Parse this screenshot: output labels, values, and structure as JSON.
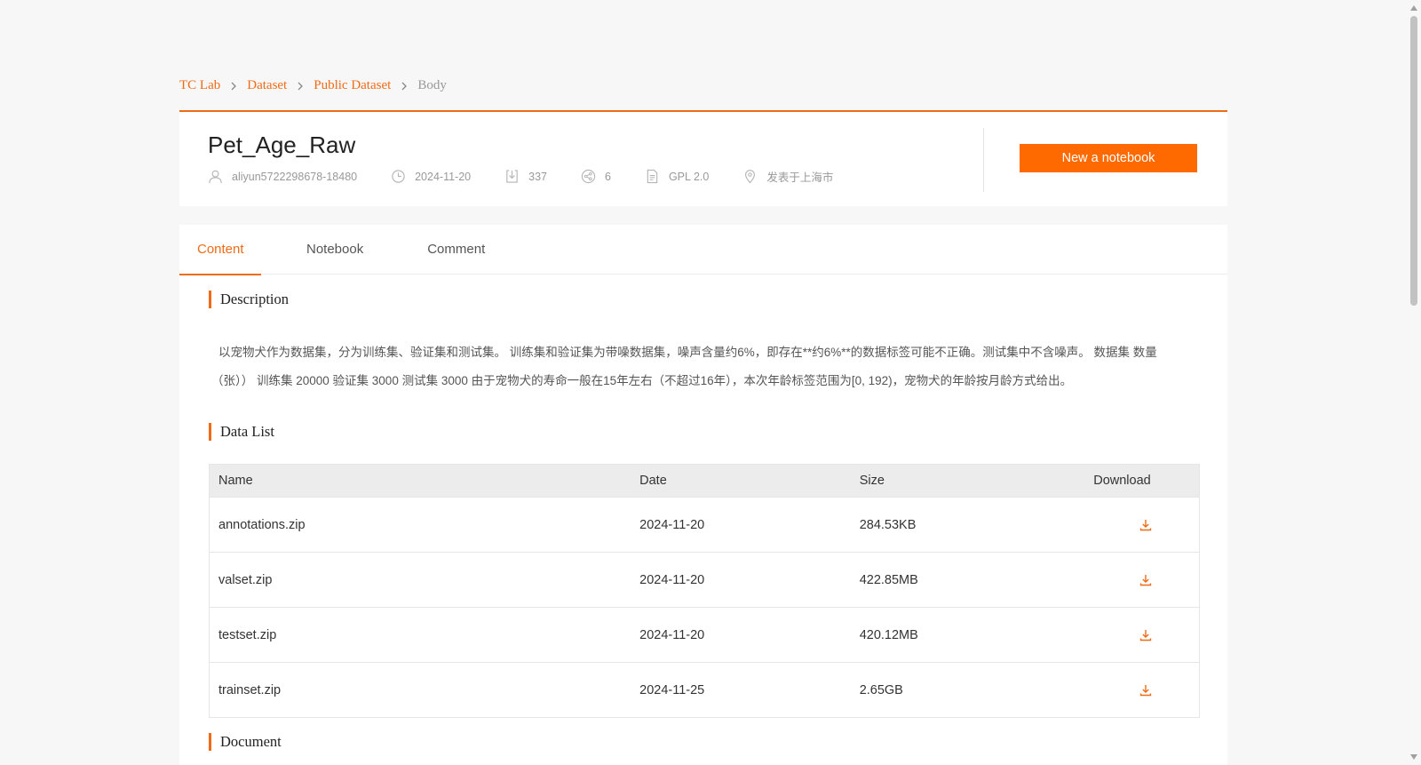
{
  "breadcrumb": {
    "items": [
      "TC Lab",
      "Dataset",
      "Public Dataset",
      "Body"
    ]
  },
  "dataset": {
    "title": "Pet_Age_Raw",
    "author": "aliyun5722298678-18480",
    "date": "2024-11-20",
    "downloads": "337",
    "shares": "6",
    "license": "GPL 2.0",
    "location": "发表于上海市"
  },
  "actions": {
    "new_notebook_label": "New a notebook"
  },
  "tabs": [
    {
      "label": "Content",
      "active": true
    },
    {
      "label": "Notebook",
      "active": false
    },
    {
      "label": "Comment",
      "active": false
    }
  ],
  "description": {
    "heading": "Description",
    "text": "以宠物犬作为数据集，分为训练集、验证集和测试集。 训练集和验证集为带噪数据集，噪声含量约6%，即存在**约6%**的数据标签可能不正确。测试集中不含噪声。 数据集 数量（张）） 训练集 20000 验证集 3000 测试集 3000 由于宠物犬的寿命一般在15年左右（不超过16年），本次年龄标签范围为[0, 192)，宠物犬的年龄按月龄方式给出。"
  },
  "data_list": {
    "heading": "Data List",
    "columns": {
      "name": "Name",
      "date": "Date",
      "size": "Size",
      "download": "Download"
    },
    "rows": [
      {
        "name": "annotations.zip",
        "date": "2024-11-20",
        "size": "284.53KB"
      },
      {
        "name": "valset.zip",
        "date": "2024-11-20",
        "size": "422.85MB"
      },
      {
        "name": "testset.zip",
        "date": "2024-11-20",
        "size": "420.12MB"
      },
      {
        "name": "trainset.zip",
        "date": "2024-11-25",
        "size": "2.65GB"
      }
    ]
  },
  "document": {
    "heading": "Document"
  },
  "icons": {
    "author": "user-icon",
    "date": "clock-icon",
    "downloads": "download-count-icon",
    "shares": "share-icon",
    "license": "document-icon",
    "location": "location-pin-icon",
    "row_download": "download-icon",
    "breadcrumb_separator": "chevron-right-icon"
  },
  "colors": {
    "accent": "#f06b16",
    "button": "#ff6a00",
    "meta_text": "#999999"
  }
}
